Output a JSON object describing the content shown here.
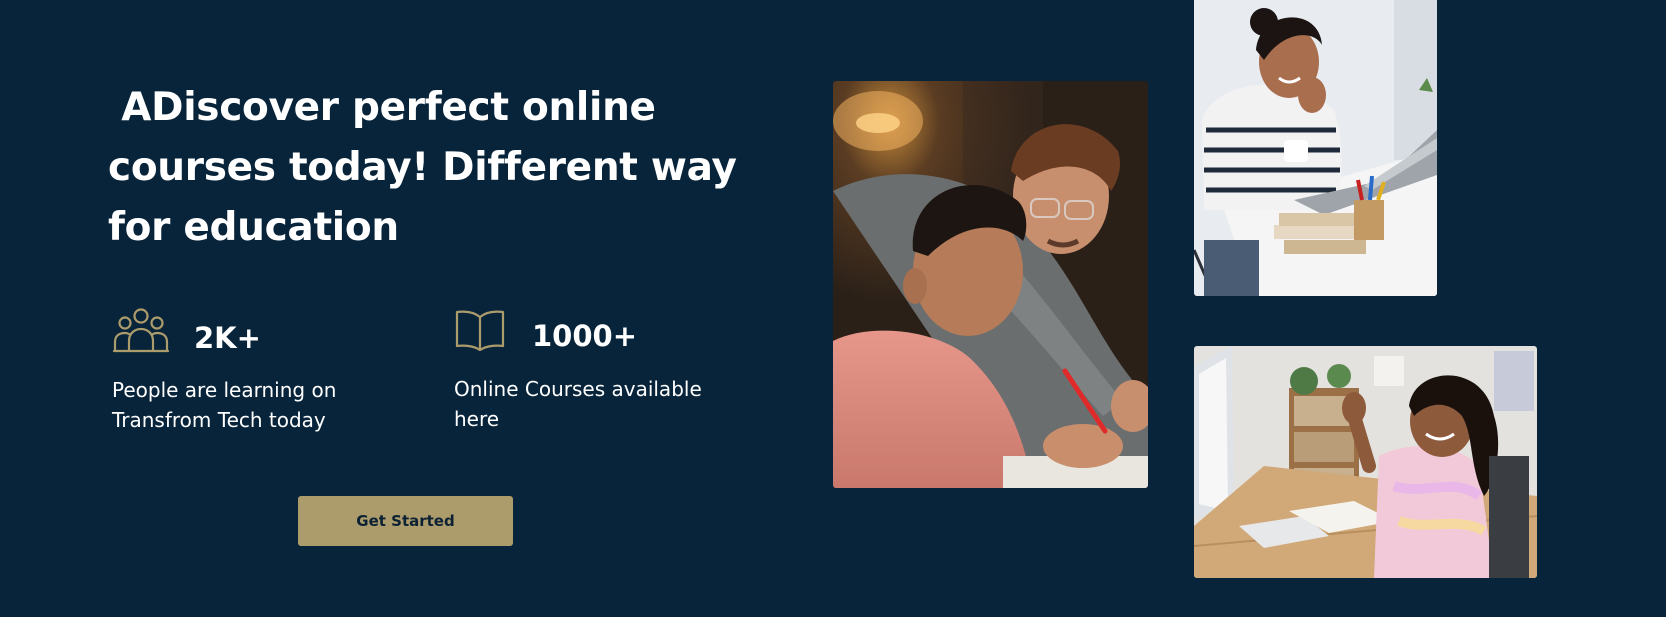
{
  "hero": {
    "title": " ADiscover perfect online courses today! Different way for education"
  },
  "stats": [
    {
      "value": "2K+",
      "description": "People are learning on Transfrom Tech today",
      "icon": "people-group-icon"
    },
    {
      "value": "1000+",
      "description": "Online Courses available here",
      "icon": "open-book-icon"
    }
  ],
  "cta": {
    "label": "Get Started"
  },
  "photos": [
    {
      "icon": "father-son-studying-photo"
    },
    {
      "icon": "woman-with-laptop-photo"
    },
    {
      "icon": "girl-waving-at-computer-photo"
    }
  ],
  "colors": {
    "background": "#08243a",
    "accent": "#ad9c6b",
    "text": "#ffffff",
    "button_text": "#0c2234"
  }
}
